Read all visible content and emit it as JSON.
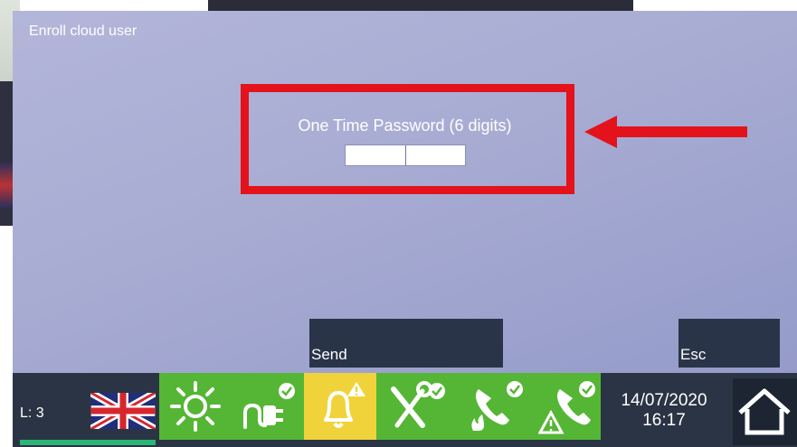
{
  "window": {
    "title": "Enroll cloud user"
  },
  "form": {
    "prompt": "One Time Password (6 digits)",
    "otp_value": ""
  },
  "softkeys": {
    "send_label": "Send",
    "esc_label": "Esc"
  },
  "status_bar": {
    "level_label": "L: 3",
    "language_flag": "uk-flag-icon",
    "icons": [
      "sun-icon",
      "power-plug-check-icon",
      "bell-warning-icon",
      "tools-check-icon",
      "phone-fire-check-icon",
      "phone-warning-check-icon"
    ],
    "date": "14/07/2020",
    "time": "16:17",
    "home_icon": "home-icon"
  },
  "colors": {
    "highlight": "#e3121b",
    "tile_green": "#55b635",
    "tile_yellow": "#f0d33a",
    "status_bar_bg": "#2b3444"
  }
}
